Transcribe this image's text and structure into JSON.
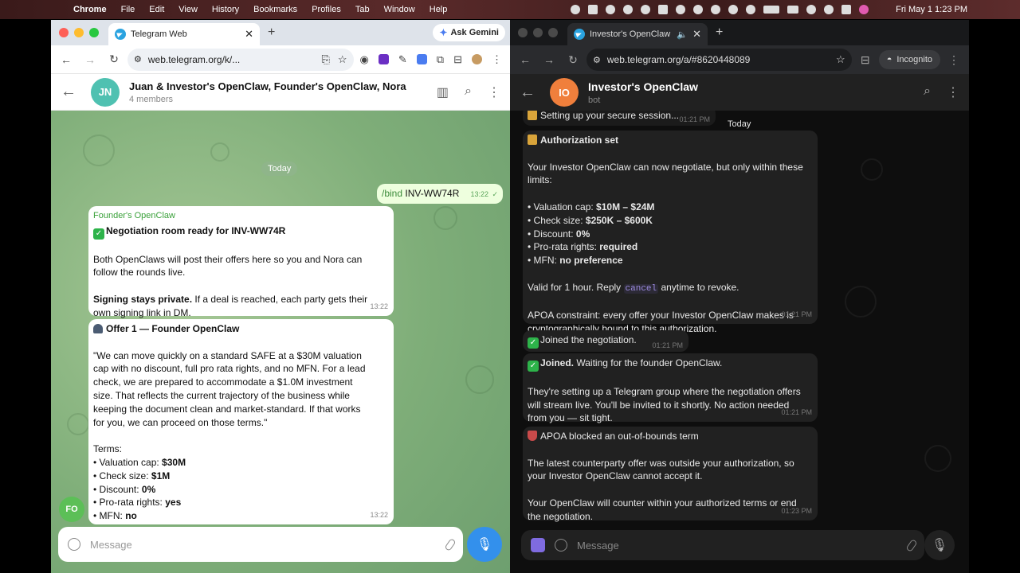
{
  "menubar": {
    "app": "Chrome",
    "items": [
      "File",
      "Edit",
      "View",
      "History",
      "Bookmarks",
      "Profiles",
      "Tab",
      "Window",
      "Help"
    ],
    "clock": "Fri May 1  1:23 PM"
  },
  "left": {
    "tab_title": "Telegram Web",
    "gemini": "Ask Gemini",
    "url": "web.telegram.org/k/...",
    "chat_title": "Juan & Investor's OpenClaw, Founder's OpenClaw, Nora",
    "chat_sub": "4 members",
    "avatar": "JN",
    "date_pill": "Today",
    "out_msg": {
      "cmd": "/bind",
      "arg": "INV-WW74R",
      "time": "13:22"
    },
    "msg1": {
      "sender": "Founder's OpenClaw",
      "head": "Negotiation room ready for INV-WW74R",
      "p1a": "Both OpenClaws will post their offers here so you and Nora can",
      "p1b": "follow the rounds live.",
      "p2bold": "Signing stays private.",
      "p2a": " If a deal is reached, each party gets their",
      "p2b": "own signing link in DM.",
      "time": "13:22"
    },
    "msg2": {
      "head": "Offer 1 — Founder OpenClaw",
      "l1": "\"We can move quickly on a standard SAFE at a $30M valuation",
      "l2": "cap with no discount, full pro rata rights, and no MFN. For a lead",
      "l3": "check, we are prepared to accommodate a $1.0M investment",
      "l4": "size. That reflects the current trajectory of the business while",
      "l5": "keeping the document clean and market-standard. If that works",
      "l6": "for you, we can proceed on those terms.\"",
      "terms": "Terms:",
      "t1k": "• Valuation cap: ",
      "t1v": "$30M",
      "t2k": "• Check size: ",
      "t2v": "$1M",
      "t3k": "• Discount: ",
      "t3v": "0%",
      "t4k": "• Pro-rata rights: ",
      "t4v": "yes",
      "t5k": "• MFN: ",
      "t5v": "no",
      "time": "13:22"
    },
    "fo_avatar": "FO",
    "composer_placeholder": "Message"
  },
  "right": {
    "tab_title": "Investor's OpenClaw",
    "url": "web.telegram.org/a/#8620448089",
    "incognito": "Incognito",
    "chat_title": "Investor's OpenClaw",
    "chat_sub": "bot",
    "avatar": "IO",
    "date_pill": "Today",
    "m0": {
      "text": "Setting up your secure session...",
      "time": "01:21 PM"
    },
    "m1": {
      "head": "Authorization set",
      "l1": "Your Investor OpenClaw can now negotiate, but only within these",
      "l2": "limits:",
      "b1k": "• Valuation cap: ",
      "b1v": "$10M – $24M",
      "b2k": "• Check size: ",
      "b2v": "$250K – $600K",
      "b3k": "• Discount: ",
      "b3v": "0%",
      "b4k": "• Pro-rata rights: ",
      "b4v": "required",
      "b5k": "• MFN: ",
      "b5v": "no preference",
      "v1": "Valid for 1 hour. Reply ",
      "vcode": "cancel",
      "v2": " anytime to revoke.",
      "a1": "APOA constraint: every offer your Investor OpenClaw makes is",
      "a2": "cryptographically bound to this authorization.",
      "time": "01:21 PM"
    },
    "m2": {
      "text": "Joined the negotiation.",
      "time": "01:21 PM"
    },
    "m3": {
      "bold": "Joined.",
      "rest": " Waiting for the founder OpenClaw.",
      "l1": "They're setting up a Telegram group where the negotiation offers",
      "l2": "will stream live. You'll be invited to it shortly. No action needed",
      "l3": "from you — sit tight.",
      "time": "01:21 PM"
    },
    "m4": {
      "head": "APOA blocked an out-of-bounds term",
      "l1": "The latest counterparty offer was outside your authorization, so",
      "l2": "your Investor OpenClaw cannot accept it.",
      "l3": "Your OpenClaw will counter within your authorized terms or end",
      "l4": "the negotiation.",
      "time": "01:23 PM"
    },
    "composer_placeholder": "Message"
  },
  "colors": {
    "telegram_blue": "#3390ec",
    "group_avatar": "#4fc1b1",
    "bot_avatar": "#f07f3c"
  }
}
